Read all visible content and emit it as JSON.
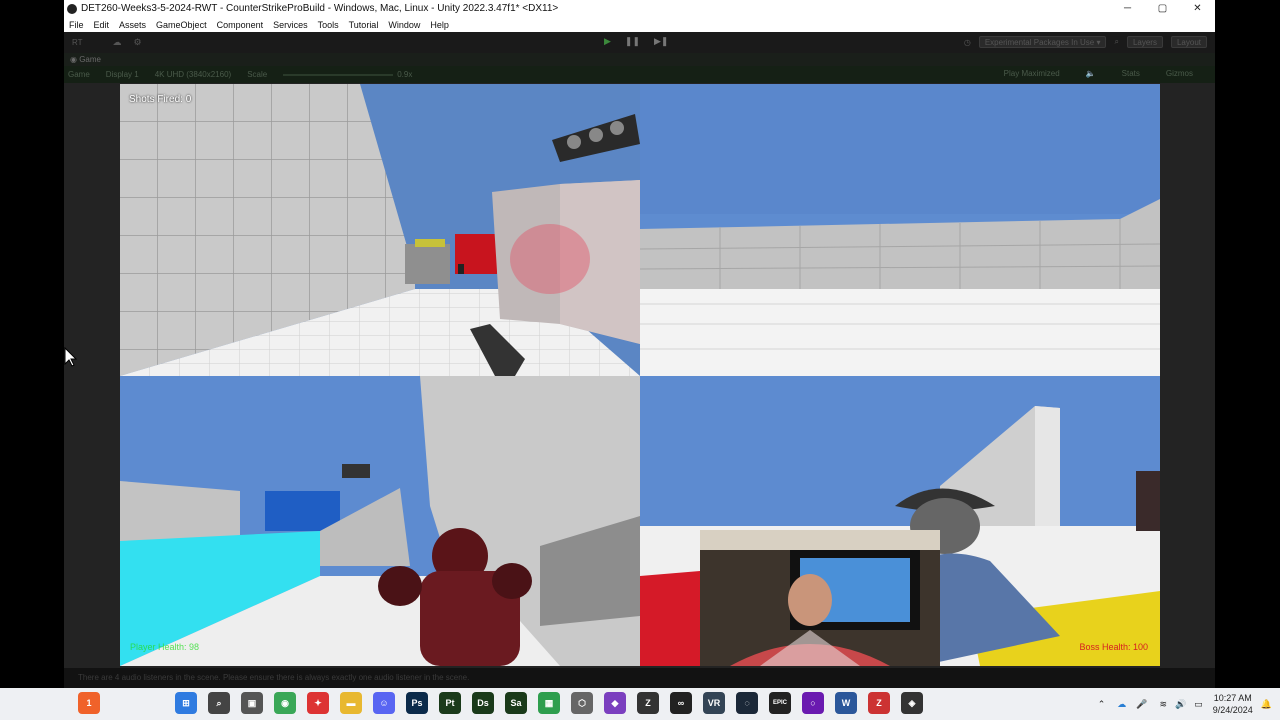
{
  "window": {
    "title": "DET260-Weeks3-5-2024-RWT - CounterStrikeProBuild - Windows, Mac, Linux - Unity 2022.3.47f1* <DX11>",
    "controls": [
      "─",
      "▢",
      "✕"
    ]
  },
  "menu": [
    "File",
    "Edit",
    "Assets",
    "GameObject",
    "Component",
    "Services",
    "Tools",
    "Tutorial",
    "Window",
    "Help"
  ],
  "toolbar": {
    "account_label": "RT",
    "packages_label": "Experimental Packages In Use ▾",
    "layers_label": "Layers",
    "layout_label": "Layout"
  },
  "game_tab": {
    "label": "Game"
  },
  "game_bar": {
    "mode": "Game",
    "display": "Display 1",
    "resolution": "4K UHD (3840x2160)",
    "scale_label": "Scale",
    "scale_value": "0.9x",
    "play_focused": "Play Maximized",
    "stats": "Stats",
    "gizmos": "Gizmos"
  },
  "hud": {
    "shots_fired": "Shots Fired: 0",
    "player_health": "Player Health: 98",
    "boss_health": "Boss Health: 100"
  },
  "statusbar": {
    "message": "There are 4 audio listeners in the scene. Please ensure there is always exactly one audio listener in the scene."
  },
  "taskbar": {
    "apps": [
      {
        "name": "notification-app",
        "label": "1",
        "color": "#f0622a"
      },
      {
        "name": "start",
        "label": "⊞",
        "color": "#2f7be0"
      },
      {
        "name": "search",
        "label": "⌕",
        "color": "#444"
      },
      {
        "name": "task-view",
        "label": "▣",
        "color": "#555"
      },
      {
        "name": "chrome",
        "label": "◉",
        "color": "#3aa757"
      },
      {
        "name": "app-red",
        "label": "✦",
        "color": "#d33"
      },
      {
        "name": "explorer",
        "label": "▬",
        "color": "#e8b830"
      },
      {
        "name": "discord",
        "label": "☺",
        "color": "#5865f2"
      },
      {
        "name": "photoshop",
        "label": "Ps",
        "color": "#0b2a4a"
      },
      {
        "name": "painter",
        "label": "Pt",
        "color": "#1a3a1a"
      },
      {
        "name": "designer",
        "label": "Ds",
        "color": "#1a3a1a"
      },
      {
        "name": "sampler",
        "label": "Sa",
        "color": "#1a3a1a"
      },
      {
        "name": "grid-app",
        "label": "▦",
        "color": "#2e9e4e"
      },
      {
        "name": "unity-hub",
        "label": "⬡",
        "color": "#666"
      },
      {
        "name": "visual-studio",
        "label": "◆",
        "color": "#7b3fbf"
      },
      {
        "name": "zbrush",
        "label": "Z",
        "color": "#333"
      },
      {
        "name": "meta",
        "label": "∞",
        "color": "#222"
      },
      {
        "name": "vr",
        "label": "VR",
        "color": "#345"
      },
      {
        "name": "steam",
        "label": "◌",
        "color": "#1b2838"
      },
      {
        "name": "epic",
        "label": "EPIC",
        "color": "#222"
      },
      {
        "name": "obs",
        "label": "○",
        "color": "#6a1ab0"
      },
      {
        "name": "word",
        "label": "W",
        "color": "#2b579a"
      },
      {
        "name": "app-z",
        "label": "Z",
        "color": "#c33"
      },
      {
        "name": "unity",
        "label": "◈",
        "color": "#333"
      }
    ],
    "clock_time": "10:27 AM",
    "clock_date": "9/24/2024"
  }
}
